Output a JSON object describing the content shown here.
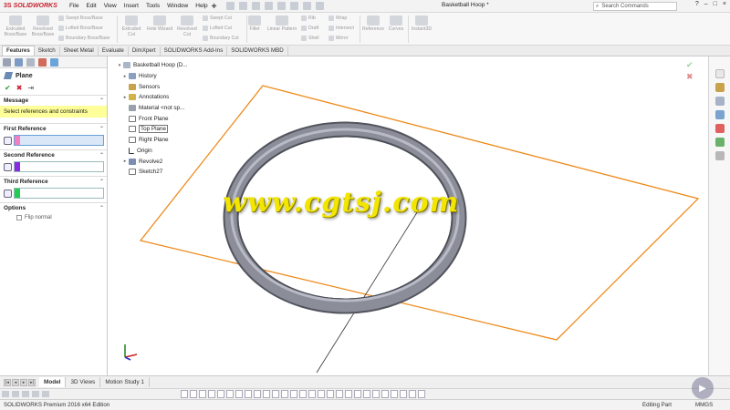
{
  "titlebar": {
    "logo_ds": "3S",
    "logo_text": "SOLIDWORKS",
    "menu": [
      "File",
      "Edit",
      "View",
      "Insert",
      "Tools",
      "Window",
      "Help"
    ],
    "document_title": "Basketball Hoop *",
    "search_placeholder": "Search Commands",
    "window_controls": [
      "?",
      "–",
      "□",
      "×"
    ]
  },
  "ribbon": {
    "big_buttons": [
      {
        "label": "Extruded Boss/Base",
        "icon": "extrude-icon"
      },
      {
        "label": "Revolved Boss/Base",
        "icon": "revolve-icon"
      },
      {
        "label": "Extruded Cut",
        "icon": "extruded-cut-icon"
      },
      {
        "label": "Hole Wizard",
        "icon": "hole-wizard-icon"
      },
      {
        "label": "Revolved Cut",
        "icon": "revolved-cut-icon"
      },
      {
        "label": "Fillet",
        "icon": "fillet-icon"
      },
      {
        "label": "Linear Pattern",
        "icon": "linear-pattern-icon"
      },
      {
        "label": "Reference Geometry",
        "icon": "reference-geometry-icon"
      },
      {
        "label": "Curves",
        "icon": "curves-icon"
      },
      {
        "label": "Instant3D",
        "icon": "instant3d-icon"
      }
    ],
    "small_buttons": [
      {
        "label": "Swept Boss/Base"
      },
      {
        "label": "Lofted Boss/Base"
      },
      {
        "label": "Boundary Boss/Base"
      },
      {
        "label": "Swept Cut"
      },
      {
        "label": "Lofted Cut"
      },
      {
        "label": "Boundary Cut"
      },
      {
        "label": "Rib"
      },
      {
        "label": "Draft"
      },
      {
        "label": "Shell"
      },
      {
        "label": "Wrap"
      },
      {
        "label": "Intersect"
      },
      {
        "label": "Mirror"
      }
    ]
  },
  "command_tabs": [
    "Features",
    "Sketch",
    "Sheet Metal",
    "Evaluate",
    "DimXpert",
    "SOLIDWORKS Add-Ins",
    "SOLIDWORKS MBD"
  ],
  "property_manager": {
    "title": "Plane",
    "message_group": "Message",
    "message": "Select references and constraints",
    "first_reference": "First Reference",
    "second_reference": "Second Reference",
    "third_reference": "Third Reference",
    "options": "Options",
    "flip_normal": "Flip normal",
    "colors": {
      "first": "#f27fbf",
      "second": "#8a2be2",
      "third": "#22cc55"
    }
  },
  "feature_tree": [
    {
      "label": "Basketball Hoop  (D...",
      "icon": "part-icon",
      "expand": "▾"
    },
    {
      "label": "History",
      "icon": "history-icon",
      "expand": "▸"
    },
    {
      "label": "Sensors",
      "icon": "sensors-icon",
      "expand": ""
    },
    {
      "label": "Annotations",
      "icon": "annotations-icon",
      "expand": "▸"
    },
    {
      "label": "Material <not sp...",
      "icon": "material-icon",
      "expand": ""
    },
    {
      "label": "Front Plane",
      "icon": "plane-icon",
      "expand": ""
    },
    {
      "label": "Top Plane",
      "icon": "plane-icon",
      "expand": ""
    },
    {
      "label": "Right Plane",
      "icon": "plane-icon",
      "expand": ""
    },
    {
      "label": "Origin",
      "icon": "origin-icon",
      "expand": ""
    },
    {
      "label": "Revolve2",
      "icon": "revolve-icon",
      "expand": "▸"
    },
    {
      "label": "Sketch27",
      "icon": "sketch-icon",
      "expand": ""
    }
  ],
  "watermark": "www.cgtsj.com",
  "bottom_tabs": [
    "Model",
    "3D Views",
    "Motion Study 1"
  ],
  "status": {
    "product": "SOLIDWORKS Premium 2016 x64 Edition",
    "mode": "Editing Part",
    "units": "MMGS"
  }
}
